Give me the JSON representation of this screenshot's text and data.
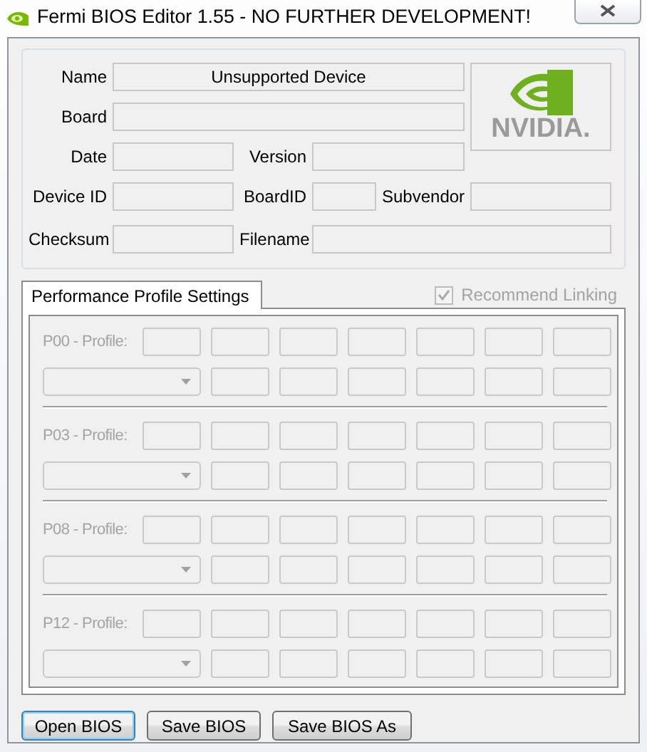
{
  "window": {
    "title": "Fermi BIOS Editor 1.55 - NO FURTHER DEVELOPMENT!"
  },
  "info": {
    "rows": [
      [
        {
          "label": "Name",
          "value": "Unsupported Device"
        }
      ],
      [
        {
          "label": "Board"
        }
      ],
      [
        {
          "label": "Date"
        },
        {
          "label": "Version"
        }
      ],
      [
        {
          "label": "Device ID"
        },
        {
          "label": "BoardID"
        },
        {
          "label": "Subvendor"
        }
      ],
      [
        {
          "label": "Checksum"
        },
        {
          "label": "Filename"
        }
      ]
    ],
    "logo": {
      "text": "NVIDIA."
    }
  },
  "tabs": [
    {
      "label": "Performance Profile Settings",
      "selected": true
    }
  ],
  "linking": {
    "label": "Recommend Linking",
    "checked": true,
    "disabled": true
  },
  "profiles": [
    {
      "label": "P00 - Profile:",
      "disabled": true
    },
    {
      "label": "P03 - Profile:",
      "disabled": true
    },
    {
      "label": "P08 - Profile:",
      "disabled": true
    },
    {
      "label": "P12 - Profile:",
      "disabled": true
    }
  ],
  "buttons": [
    {
      "label": "Open BIOS",
      "default": true
    },
    {
      "label": "Save BIOS",
      "default": false
    },
    {
      "label": "Save BIOS As",
      "default": false
    }
  ]
}
